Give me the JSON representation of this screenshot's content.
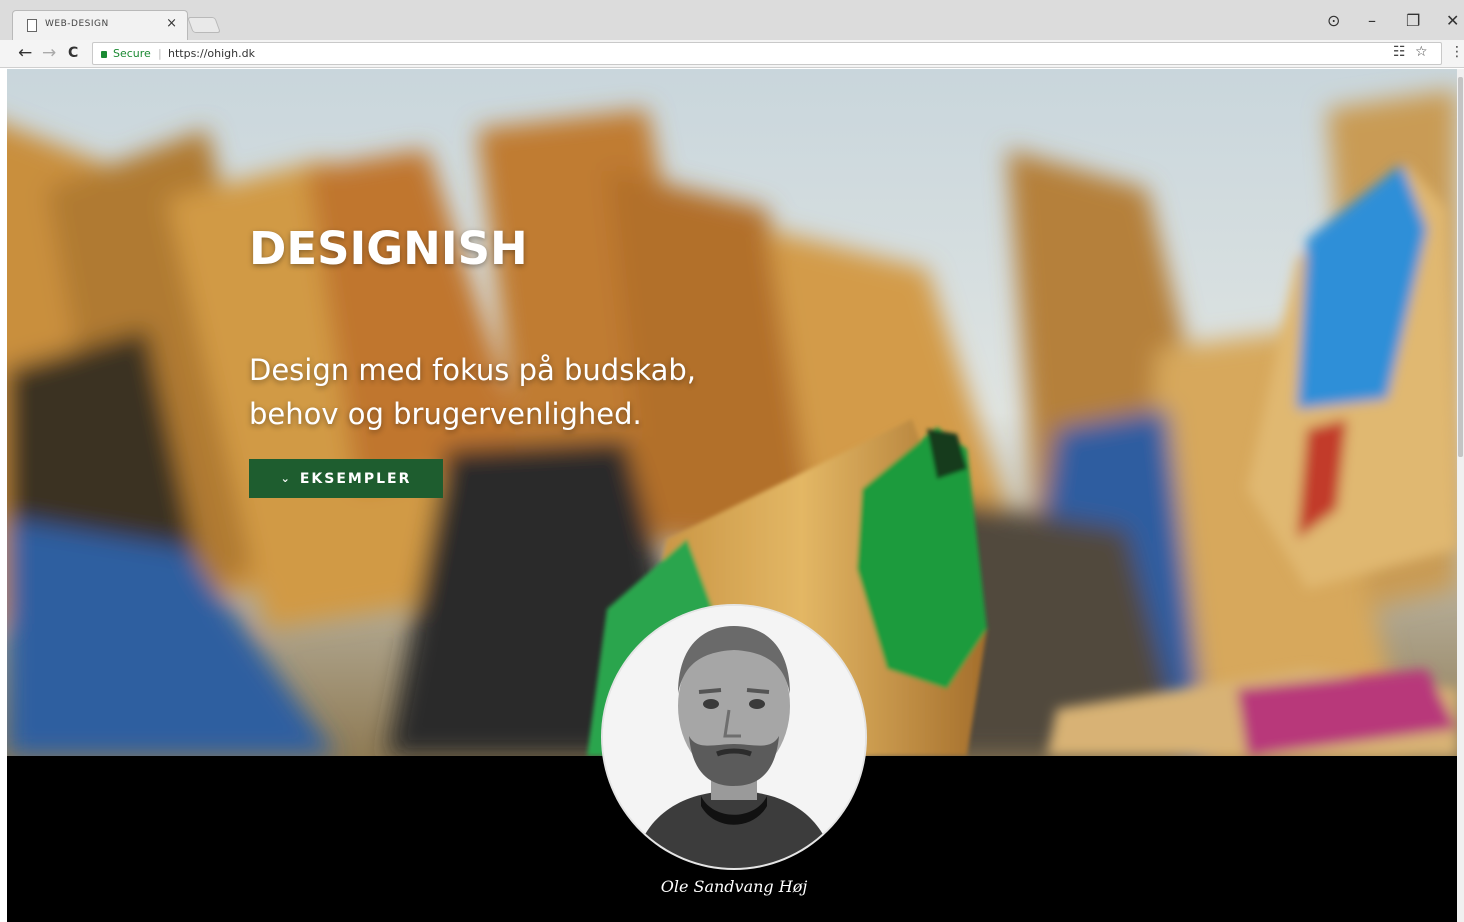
{
  "browser": {
    "tab_title": "WEB-DESIGN",
    "tab_close": "×",
    "secure_label": "Secure",
    "url": "https://ohigh.dk",
    "window_controls": {
      "account": "⊙",
      "minimize": "–",
      "restore": "❐",
      "close": "✕"
    },
    "nav": {
      "back": "←",
      "forward": "→",
      "reload": "C"
    },
    "omnibox_icons": {
      "translate": "☷",
      "star": "☆",
      "menu": "⋮"
    }
  },
  "hero": {
    "title": "DESIGNISH",
    "tagline_line1": "Design med fokus på budskab,",
    "tagline_line2": "behov og brugervenlighed.",
    "button_icon": "chevron-down-icon",
    "button_label": "EKSEMPLER",
    "button_color": "#1e5d2f"
  },
  "profile": {
    "name": "Ole Sandvang Høj"
  },
  "colors": {
    "secure": "#1a8a32",
    "footer_bg": "#000000"
  }
}
